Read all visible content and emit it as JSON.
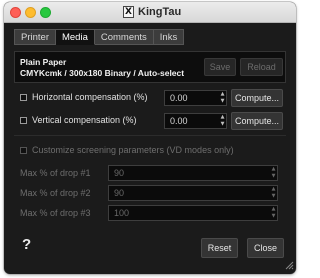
{
  "window": {
    "title": "KingTau",
    "app_icon": "x-logo-icon"
  },
  "tabs": [
    {
      "label": "Printer",
      "active": false
    },
    {
      "label": "Media",
      "active": true
    },
    {
      "label": "Comments",
      "active": false
    },
    {
      "label": "Inks",
      "active": false
    }
  ],
  "media": {
    "paper_name": "Plain Paper",
    "paper_description": "CMYKcmk / 300x180 Binary / Auto-select",
    "save_label": "Save",
    "reload_label": "Reload"
  },
  "compensation": {
    "horizontal": {
      "label": "Horizontal compensation (%)",
      "value": "0.00",
      "button": "Compute...",
      "checked": false
    },
    "vertical": {
      "label": "Vertical compensation (%)",
      "value": "0.00",
      "button": "Compute...",
      "checked": false
    }
  },
  "screening": {
    "label": "Customize screening parameters (VD modes only)",
    "checked": false,
    "drops": [
      {
        "label": "Max % of drop #1",
        "value": "90"
      },
      {
        "label": "Max % of drop #2",
        "value": "90"
      },
      {
        "label": "Max % of drop #3",
        "value": "100"
      }
    ]
  },
  "footer": {
    "help": "?",
    "reset_label": "Reset",
    "close_label": "Close"
  },
  "colors": {
    "background": "#1b1b1b",
    "field": "#0b0b0b",
    "button": "#343434",
    "active_tab": "#111111",
    "disabled_text": "#6e6e6e"
  }
}
